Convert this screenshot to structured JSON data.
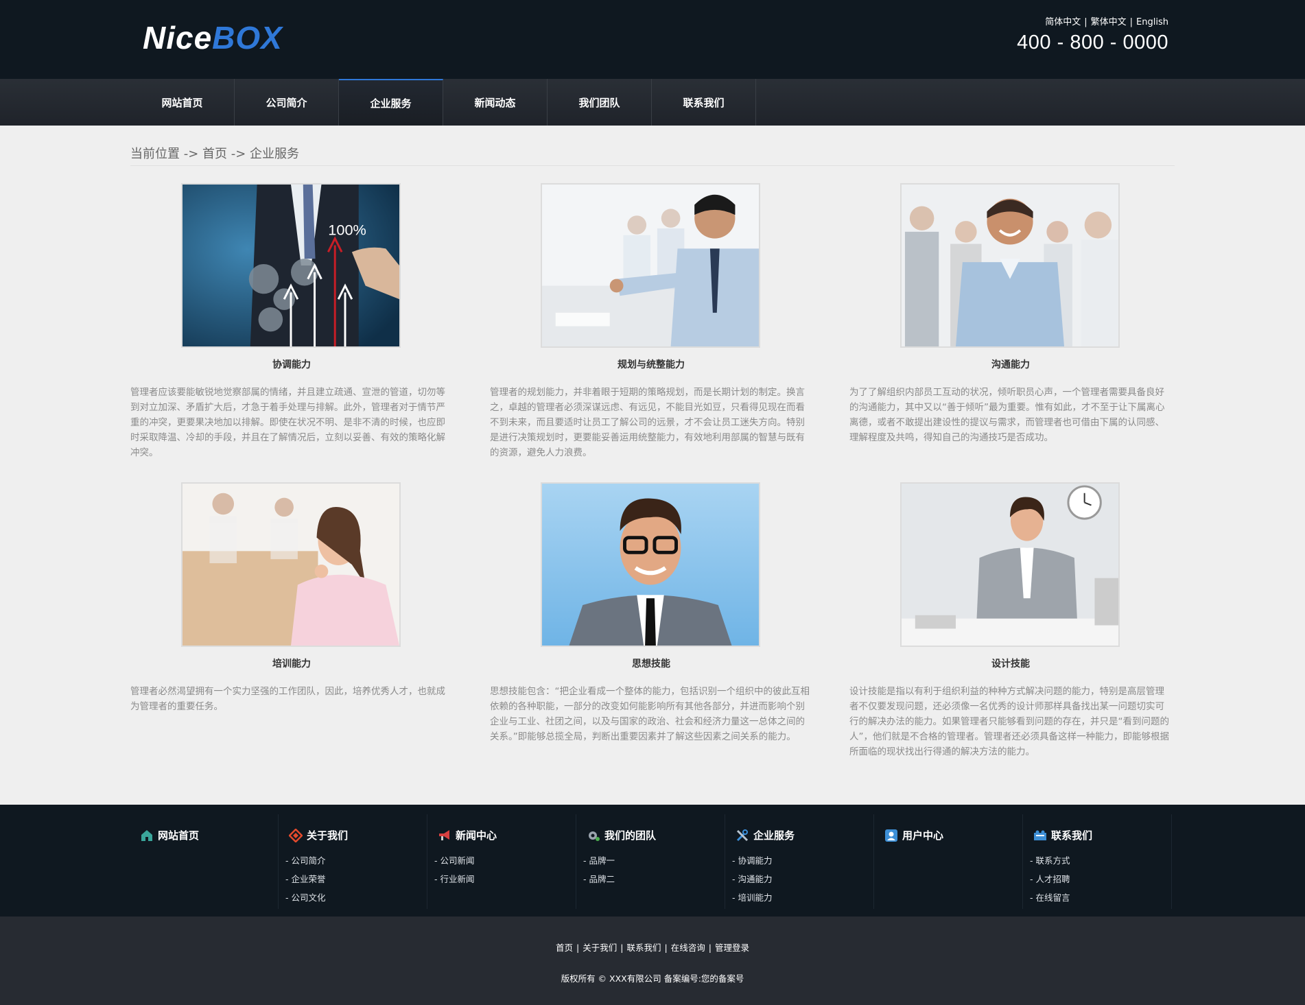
{
  "header": {
    "logo_part1": "Nice",
    "logo_part2": "BOX",
    "lang": [
      "简体中文",
      "繁体中文",
      "English"
    ],
    "phone": "400 - 800 - 0000"
  },
  "nav": {
    "items": [
      "网站首页",
      "公司简介",
      "企业服务",
      "新闻动态",
      "我们团队",
      "联系我们"
    ],
    "active": "企业服务"
  },
  "breadcrumb": "当前位置 -> 首页 -> 企业服务",
  "cards": [
    {
      "title": "协调能力",
      "desc": "管理者应该要能敏锐地觉察部属的情绪，并且建立疏通、宣泄的管道，切勿等到对立加深、矛盾扩大后，才急于着手处理与排解。此外，管理者对于情节严重的冲突，更要果决地加以排解。即使在状况不明、是非不清的时候，也应即时采取降温、冷却的手段，并且在了解情况后，立刻以妥善、有效的策略化解冲突。",
      "image_text": "100%",
      "icon": "business-growth-photo"
    },
    {
      "title": "规划与统整能力",
      "desc": "管理者的规划能力，并非着眼于短期的策略规划，而是长期计划的制定。换言之，卓越的管理者必须深谋远虑、有远见，不能目光如豆，只看得见现在而看不到未来，而且要适时让员工了解公司的远景，才不会让员工迷失方向。特别是进行决策规划时，更要能妥善运用统整能力，有效地利用部属的智慧与既有的资源，避免人力浪费。",
      "icon": "meeting-photo"
    },
    {
      "title": "沟通能力",
      "desc": "为了了解组织内部员工互动的状况，倾听职员心声，一个管理者需要具备良好的沟通能力，其中又以“善于倾听”最为重要。惟有如此，才不至于让下属离心离德，或者不敢提出建设性的提议与需求，而管理者也可借由下属的认同感、理解程度及共鸣，得知自己的沟通技巧是否成功。",
      "icon": "team-photo"
    },
    {
      "title": "培训能力",
      "desc": "管理者必然渴望拥有一个实力坚强的工作团队，因此，培养优秀人才，也就成为管理者的重要任务。",
      "icon": "woman-office-photo"
    },
    {
      "title": "思想技能",
      "desc": "思想技能包含：“把企业看成一个整体的能力，包括识别一个组织中的彼此互相依赖的各种职能，一部分的改变如何能影响所有其他各部分，并进而影响个别企业与工业、社团之间，以及与国家的政治、社会和经济力量这一总体之间的关系。”即能够总揽全局，判断出重要因素并了解这些因素之间关系的能力。",
      "icon": "man-glasses-photo"
    },
    {
      "title": "设计技能",
      "desc": "设计技能是指以有利于组织利益的种种方式解决问题的能力，特别是高层管理者不仅要发现问题，还必须像一名优秀的设计师那样具备找出某一问题切实可行的解决办法的能力。如果管理者只能够看到问题的存在，并只是“看到问题的人”，他们就是不合格的管理者。管理者还必须具备这样一种能力，即能够根据所面临的现状找出行得通的解决方法的能力。",
      "icon": "businesswoman-desk-photo"
    }
  ],
  "footer": {
    "columns": [
      {
        "title": "网站首页",
        "icon": "home-icon",
        "items": []
      },
      {
        "title": "关于我们",
        "icon": "diamond-icon",
        "items": [
          "- 公司简介",
          "- 企业荣誉",
          "- 公司文化"
        ]
      },
      {
        "title": "新闻中心",
        "icon": "megaphone-icon",
        "items": [
          "- 公司新闻",
          "- 行业新闻"
        ]
      },
      {
        "title": "我们的团队",
        "icon": "gear-icon",
        "items": [
          "- 品牌一",
          "- 品牌二"
        ]
      },
      {
        "title": "企业服务",
        "icon": "tools-icon",
        "items": [
          "- 协调能力",
          "- 沟通能力",
          "- 培训能力"
        ]
      },
      {
        "title": "用户中心",
        "icon": "user-icon",
        "items": []
      },
      {
        "title": "联系我们",
        "icon": "contact-icon",
        "items": [
          "- 联系方式",
          "- 人才招聘",
          "- 在线留言"
        ]
      }
    ],
    "bottom_links": [
      "首页",
      "关于我们",
      "联系我们",
      "在线咨询",
      "管理登录"
    ],
    "copyright": "版权所有 © XXX有限公司  备案编号:您的备案号"
  },
  "colors": {
    "header_bg": "#0f1820",
    "accent": "#2f78d8",
    "page_bg": "#efefef",
    "bottom_bg": "#272b32"
  }
}
